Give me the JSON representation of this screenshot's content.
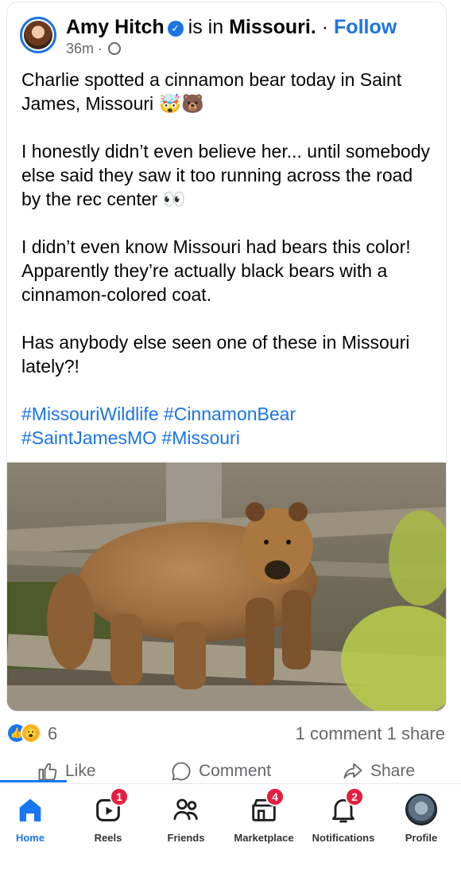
{
  "post": {
    "author": "Amy Hitch",
    "location_prefix": "is in",
    "location": "Missouri.",
    "follow_sep": " · ",
    "follow_label": "Follow",
    "time": "36m",
    "meta_sep": " · ",
    "paragraphs": [
      "Charlie spotted a cinnamon bear today in Saint James, Missouri 🤯🐻",
      "I honestly didn’t even believe her... until somebody else said they saw it too running across the road by the rec center 👀",
      "I didn’t even know Missouri had bears this color! Apparently they’re actually black bears with a cinnamon-colored coat.",
      "Has anybody else seen one of these in Missouri lately?!"
    ],
    "hashtags": "#MissouriWildlife #CinnamonBear #SaintJamesMO #Missouri"
  },
  "stats": {
    "reaction_count": "6",
    "comments": "1 comment",
    "shares": "1 share"
  },
  "actions": {
    "like": "Like",
    "comment": "Comment",
    "share": "Share"
  },
  "tabs": [
    {
      "label": "Home",
      "badge": ""
    },
    {
      "label": "Reels",
      "badge": "1"
    },
    {
      "label": "Friends",
      "badge": ""
    },
    {
      "label": "Marketplace",
      "badge": "4"
    },
    {
      "label": "Notifications",
      "badge": "2"
    },
    {
      "label": "Profile",
      "badge": ""
    }
  ],
  "colors": {
    "accent": "#1877f2",
    "badge": "#e41e3f",
    "secondary_text": "#65676b"
  },
  "icons": [
    "verified-icon",
    "globe-icon",
    "like-reaction-icon",
    "wow-reaction-icon",
    "like-icon",
    "comment-icon",
    "share-icon",
    "home-icon",
    "reels-icon",
    "friends-icon",
    "marketplace-icon",
    "notifications-icon"
  ]
}
